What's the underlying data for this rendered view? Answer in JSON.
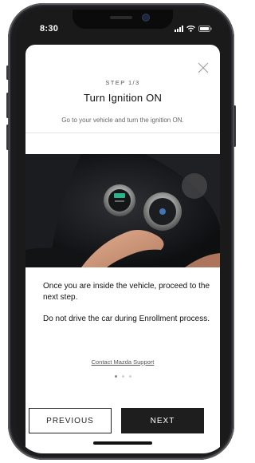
{
  "status_bar": {
    "time": "8:30"
  },
  "modal": {
    "step": "STEP 1/3",
    "title": "Turn Ignition ON",
    "subtitle": "Go to your vehicle and turn the ignition ON.",
    "body": [
      "Once you are inside the vehicle, proceed to the next step.",
      "Do not drive the car during Enrollment process."
    ],
    "support_link": "Contact Mazda Support",
    "pagination": {
      "current": 1,
      "total": 3
    },
    "buttons": {
      "previous": "PREVIOUS",
      "next": "NEXT"
    }
  }
}
